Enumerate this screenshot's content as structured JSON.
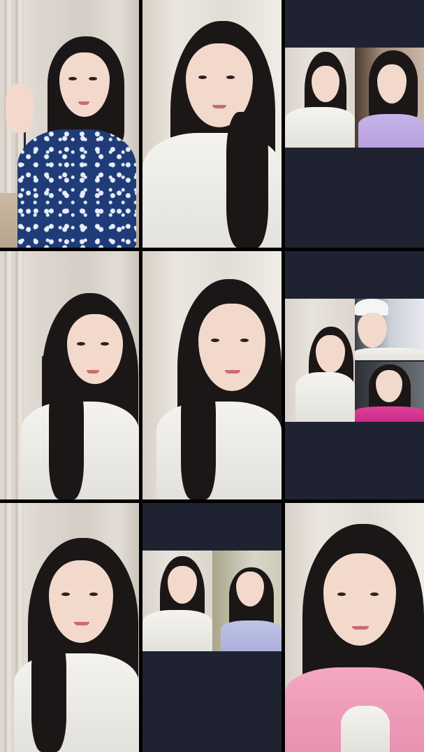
{
  "screen": {
    "layout": "3x3 video grid",
    "background_color": "#000000",
    "empty_area_color": "#1f2230"
  },
  "tiles": [
    {
      "name": "host-dancing-blue-dress",
      "kind": "video"
    },
    {
      "name": "host-white-tshirt-closeup",
      "kind": "video"
    },
    {
      "name": "duo-call-white-and-purple",
      "kind": "video-inset"
    },
    {
      "name": "host-white-tshirt-side",
      "kind": "video"
    },
    {
      "name": "host-white-tshirt-talking",
      "kind": "video"
    },
    {
      "name": "trio-call-cap-and-magenta",
      "kind": "video-inset"
    },
    {
      "name": "host-white-tshirt-smile",
      "kind": "video"
    },
    {
      "name": "duo-call-white-and-lavender",
      "kind": "video-inset"
    },
    {
      "name": "host-pink-cardigan-smile",
      "kind": "video"
    }
  ]
}
